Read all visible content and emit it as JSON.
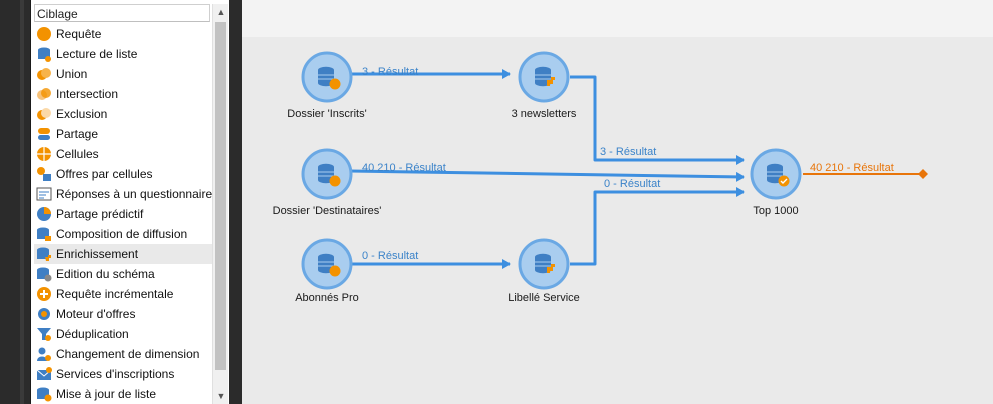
{
  "palette": {
    "header": "Ciblage",
    "items": [
      {
        "label": "Requête",
        "icon": "query-icon"
      },
      {
        "label": "Lecture de liste",
        "icon": "list-read-icon"
      },
      {
        "label": "Union",
        "icon": "union-icon"
      },
      {
        "label": "Intersection",
        "icon": "intersection-icon"
      },
      {
        "label": "Exclusion",
        "icon": "exclusion-icon"
      },
      {
        "label": "Partage",
        "icon": "split-icon"
      },
      {
        "label": "Cellules",
        "icon": "cells-icon"
      },
      {
        "label": "Offres par cellules",
        "icon": "offers-cells-icon"
      },
      {
        "label": "Réponses à un questionnaire",
        "icon": "survey-icon"
      },
      {
        "label": "Partage prédictif",
        "icon": "predictive-split-icon"
      },
      {
        "label": "Composition de diffusion",
        "icon": "delivery-composition-icon"
      },
      {
        "label": "Enrichissement",
        "icon": "enrichment-icon"
      },
      {
        "label": "Edition du schéma",
        "icon": "schema-edit-icon"
      },
      {
        "label": "Requête incrémentale",
        "icon": "incremental-query-icon"
      },
      {
        "label": "Moteur d'offres",
        "icon": "offer-engine-icon"
      },
      {
        "label": "Déduplication",
        "icon": "dedup-icon"
      },
      {
        "label": "Changement de dimension",
        "icon": "dimension-change-icon"
      },
      {
        "label": "Services d'inscriptions",
        "icon": "subscription-services-icon"
      },
      {
        "label": "Mise à jour de liste",
        "icon": "list-update-icon"
      }
    ],
    "selected": "Enrichissement"
  },
  "workflow": {
    "nodes": [
      {
        "id": "n1",
        "label": "Dossier 'Inscrits'",
        "icon": "query-node-icon"
      },
      {
        "id": "n2",
        "label": "3 newsletters",
        "icon": "enrichment-node-icon"
      },
      {
        "id": "n3",
        "label": "Dossier 'Destinataires'",
        "icon": "query-node-icon"
      },
      {
        "id": "n4",
        "label": "Top 1000",
        "icon": "enrichment-result-node-icon"
      },
      {
        "id": "n5",
        "label": "Abonnés Pro",
        "icon": "query-node-icon"
      },
      {
        "id": "n6",
        "label": "Libellé Service",
        "icon": "enrichment-node-icon"
      }
    ],
    "edges": [
      {
        "label": "3 - Résultat"
      },
      {
        "label": "3 - Résultat"
      },
      {
        "label": "40 210 - Résultat"
      },
      {
        "label": "0 - Résultat"
      },
      {
        "label": "0 - Résultat"
      },
      {
        "label": "40 210 - Résultat"
      }
    ],
    "colors": {
      "edge": "#3d8fe0",
      "output_edge": "#e8750a",
      "node_fill": "#a9cdef",
      "node_border": "#6aa8e4",
      "db_blue": "#3f7fc4",
      "accent_orange": "#f39200"
    }
  }
}
